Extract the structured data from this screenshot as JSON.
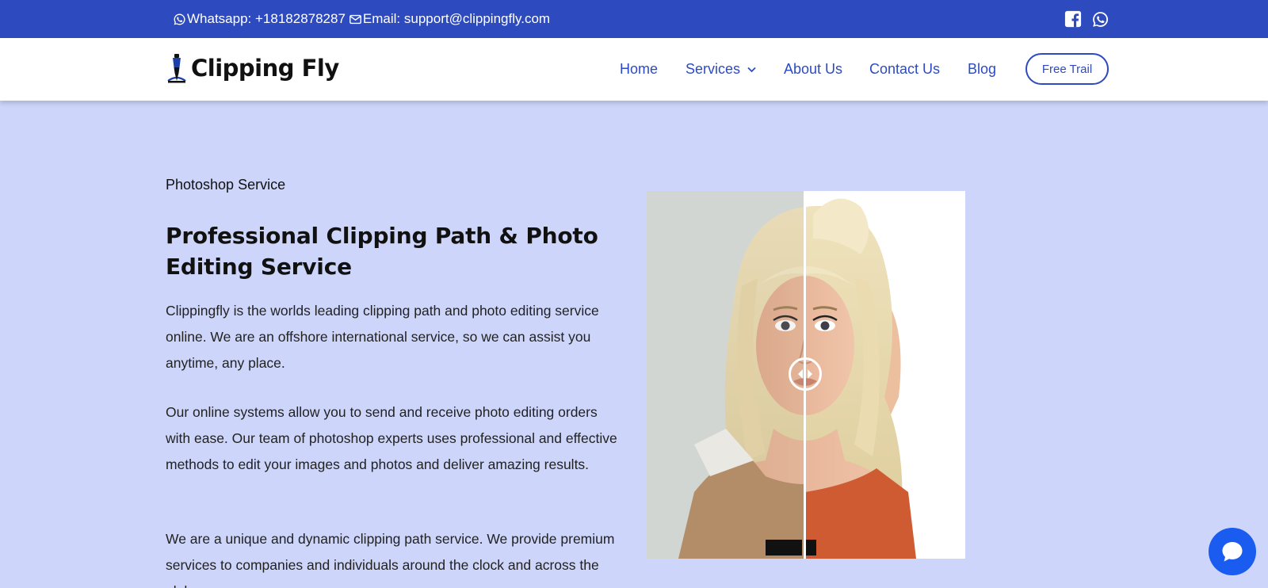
{
  "topbar": {
    "whatsapp_text": "Whatsapp: +18182878287",
    "email_text": "Email: support@clippingfly.com",
    "whatsapp_icon": "whatsapp-icon",
    "email_icon": "envelope-icon",
    "social": [
      "facebook-square-icon",
      "whatsapp-icon"
    ]
  },
  "header": {
    "logo_text": "Clipping Fly",
    "nav": {
      "home": "Home",
      "services": "Services",
      "about": "About Us",
      "contact": "Contact Us",
      "blog": "Blog"
    },
    "cta": "Free Trail"
  },
  "hero": {
    "eyebrow": "Photoshop Service",
    "title": "Professional Clipping Path & Photo Editing Service",
    "paragraphs": [
      "Clippingfly is the worlds leading clipping path and photo editing service online. We are an offshore international service, so we can assist you anytime, any place.",
      "Our online systems allow you to send and receive photo editing orders with ease. Our team of photoshop experts uses professional and effective methods to edit your images and photos and deliver amazing results.",
      "We are a unique and dynamic clipping path service. We provide premium services to companies and individuals around the clock and across the globe."
    ],
    "comparison": {
      "slider_position": 0.5,
      "handle_icon": "left-right-arrows-icon"
    }
  },
  "chat": {
    "icon": "chat-bubble-icon"
  },
  "colors": {
    "brand_blue": "#2d4bbf",
    "page_bg": "#cdd6fa",
    "chat_blue": "#1a5cf0"
  }
}
